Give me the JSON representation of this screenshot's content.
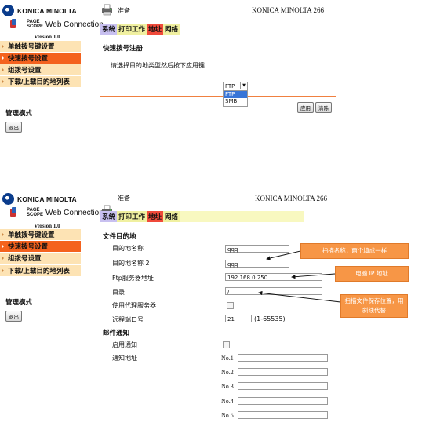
{
  "panel1": {
    "brand": "KONICA MINOLTA",
    "pagescope_top": "PAGE",
    "pagescope_bottom": "SCOPE",
    "web_connection": "Web Connection",
    "version": "Version 1.0",
    "status": "准备",
    "model": "KONICA MINOLTA 266",
    "tabs": [
      "系统",
      "打印工作",
      "地址",
      "网络"
    ],
    "sidebar": [
      "单触拨号键设置",
      "快速拨号设置",
      "组拨号设置",
      "下载/上载目的地列表"
    ],
    "management": "管理模式",
    "logout": "退出",
    "section_title": "快速拨号注册",
    "instruction": "请选择目的地类型然后按下应用键",
    "dest_type_selected": "FTP",
    "dest_type_options": [
      "FTP",
      "SMB"
    ],
    "apply": "应用",
    "clear": "清除"
  },
  "panel2": {
    "brand": "KONICA MINOLTA",
    "pagescope_top": "PAGE",
    "pagescope_bottom": "SCOPE",
    "web_connection": "Web Connection",
    "version": "Version 1.0",
    "status": "准备",
    "model": "KONICA MINOLTA 266",
    "tabs": [
      "系统",
      "打印工作",
      "地址",
      "网络"
    ],
    "sidebar": [
      "单触拨号键设置",
      "快速拨号设置",
      "组拨号设置",
      "下载/上载目的地列表"
    ],
    "management": "管理模式",
    "logout": "退出",
    "section_title": "文件目的地",
    "fields": {
      "dest_name": {
        "label": "目的地名称",
        "value": "qqq"
      },
      "dest_name2": {
        "label": "目的地名称 2",
        "value": "qqq"
      },
      "ftp_server": {
        "label": "Ftp服务器地址",
        "value": "192.168.0.250"
      },
      "directory": {
        "label": "目录",
        "value": "/"
      },
      "use_proxy": {
        "label": "使用代理服务器"
      },
      "remote_port": {
        "label": "远程端口号",
        "value": "21",
        "range": "(1-65535)"
      }
    },
    "mail_section": "邮件通知",
    "enable_notify": "启用通知",
    "notify_address": "通知地址",
    "notify_slots": [
      "No.1",
      "No.2",
      "No.3",
      "No.4",
      "No.5"
    ],
    "callouts": {
      "name": "扫描名称，两个填成一样",
      "ip": "电脑 IP 地址",
      "folder": "扫描文件保存位置，用斜线代替"
    }
  },
  "colors": {
    "sidebar_bg": "#fde3b4",
    "sidebar_active": "#f4621e",
    "tab_system": "#c8c0f0",
    "tab_address": "#f04a3a",
    "callout": "#f79646",
    "rule": "#f08040"
  }
}
